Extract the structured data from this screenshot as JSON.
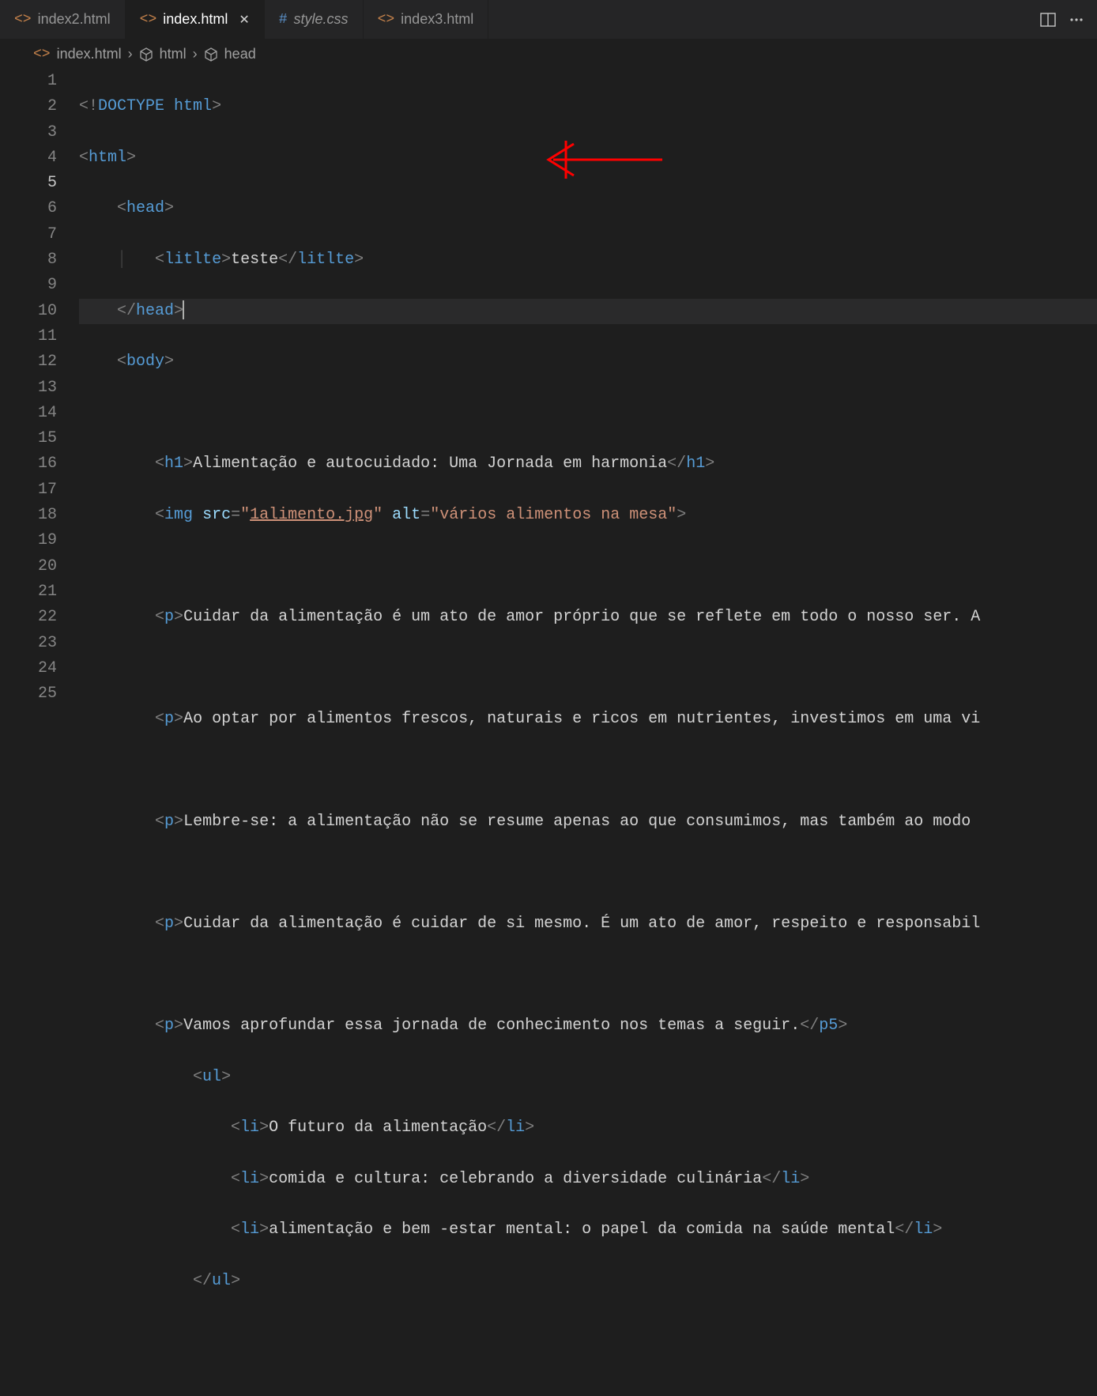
{
  "tabs": [
    {
      "label": "index2.html",
      "icon": "<>",
      "active": false,
      "italic": false,
      "type": "html"
    },
    {
      "label": "index.html",
      "icon": "<>",
      "active": true,
      "italic": false,
      "type": "html"
    },
    {
      "label": "style.css",
      "icon": "#",
      "active": false,
      "italic": true,
      "type": "css"
    },
    {
      "label": "index3.html",
      "icon": "<>",
      "active": false,
      "italic": false,
      "type": "html"
    }
  ],
  "breadcrumbs": {
    "file": "index.html",
    "segments": [
      "html",
      "head"
    ]
  },
  "lines": {
    "count": 25,
    "active": 5
  },
  "code": {
    "l1_doctype": "DOCTYPE",
    "l1_html": "html",
    "l2_tag": "html",
    "l3_tag": "head",
    "l4_tag": "litlte",
    "l4_text": "teste",
    "l5_tag": "head",
    "l6_tag": "body",
    "l8_tag": "h1",
    "l8_text": "Alimentação e autocuidado: Uma Jornada em harmonia",
    "l9_tag": "img",
    "l9_attr_src": "src",
    "l9_val_src": "1alimento.jpg",
    "l9_attr_alt": "alt",
    "l9_val_alt": "vários alimentos na mesa",
    "l11_tag": "p",
    "l11_text": "Cuidar da alimentação é um ato de amor próprio que se reflete em todo o nosso ser. A",
    "l13_tag": "p",
    "l13_text": "Ao optar por alimentos frescos, naturais e ricos em nutrientes, investimos em uma vi",
    "l15_tag": "p",
    "l15_text": "Lembre-se: a alimentação não se resume apenas ao que consumimos, mas também ao modo ",
    "l17_tag": "p",
    "l17_text": "Cuidar da alimentação é cuidar de si mesmo. É um ato de amor, respeito e responsabil",
    "l19_tag": "p",
    "l19_text": "Vamos aprofundar essa jornada de conhecimento nos temas a seguir.",
    "l19_close": "p5",
    "l20_tag": "ul",
    "l21_tag": "li",
    "l21_text": "O futuro da alimentação",
    "l22_tag": "li",
    "l22_text": "comida e cultura: celebrando a diversidade culinária",
    "l23_tag": "li",
    "l23_text": "alimentação e bem -estar mental: o papel da comida na saúde mental",
    "l24_tag": "ul"
  }
}
